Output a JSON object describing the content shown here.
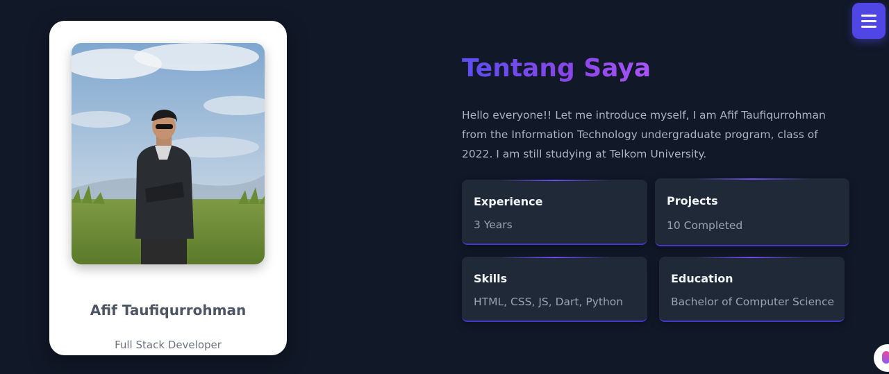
{
  "profile": {
    "name": "Afif Taufiqurrohman",
    "role": "Full Stack Developer"
  },
  "about": {
    "title": "Tentang Saya",
    "description": "Hello everyone!! Let me introduce myself, I am Afif Taufiqurrohman from the Information Technology undergraduate program, class of 2022. I am still studying at Telkom University."
  },
  "stats": {
    "experience": {
      "label": "Experience",
      "value": "3 Years"
    },
    "projects": {
      "label": "Projects",
      "value": "10 Completed"
    },
    "skills": {
      "label": "Skills",
      "value": "HTML, CSS, JS, Dart, Python"
    },
    "education": {
      "label": "Education",
      "value": "Bachelor of Computer Science"
    }
  },
  "icons": {
    "menu": "hamburger-menu-icon",
    "corner": "chat-widget-icon"
  },
  "colors": {
    "background": "#111827",
    "card": "#1f2937",
    "accent": "#4f46e5",
    "title_gradient_start": "#5b4ef0",
    "title_gradient_end": "#a855f7"
  }
}
